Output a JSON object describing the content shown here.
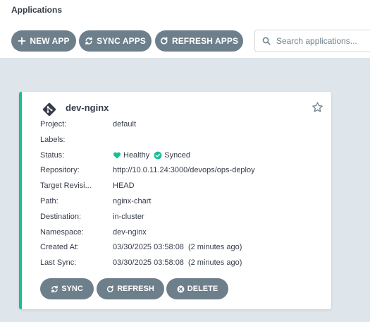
{
  "header": {
    "title": "Applications"
  },
  "toolbar": {
    "new_app": "NEW APP",
    "sync_apps": "SYNC APPS",
    "refresh_apps": "REFRESH APPS"
  },
  "search": {
    "placeholder": "Search applications..."
  },
  "app": {
    "name": "dev-nginx",
    "fields": [
      {
        "label": "Project:",
        "value": "default"
      },
      {
        "label": "Labels:",
        "value": ""
      },
      {
        "label": "Status:",
        "health": "Healthy",
        "sync": "Synced"
      },
      {
        "label": "Repository:",
        "value": "http://10.0.11.24:3000/devops/ops-deploy"
      },
      {
        "label": "Target Revisi...",
        "value": "HEAD"
      },
      {
        "label": "Path:",
        "value": "nginx-chart"
      },
      {
        "label": "Destination:",
        "value": "in-cluster"
      },
      {
        "label": "Namespace:",
        "value": "dev-nginx"
      },
      {
        "label": "Created At:",
        "value": "03/30/2025 03:58:08",
        "relative": "(2 minutes ago)"
      },
      {
        "label": "Last Sync:",
        "value": "03/30/2025 03:58:08",
        "relative": "(2 minutes ago)"
      }
    ],
    "actions": {
      "sync": "SYNC",
      "refresh": "REFRESH",
      "delete": "DELETE"
    }
  },
  "colors": {
    "healthy": "#18be94",
    "synced": "#18be94",
    "button": "#6d7f8b",
    "background": "#dee6eb"
  },
  "icons": [
    "plus-icon",
    "sync-icon",
    "refresh-icon",
    "search-icon",
    "git-icon",
    "star-icon",
    "heart-icon",
    "check-circle-icon",
    "times-circle-icon"
  ]
}
